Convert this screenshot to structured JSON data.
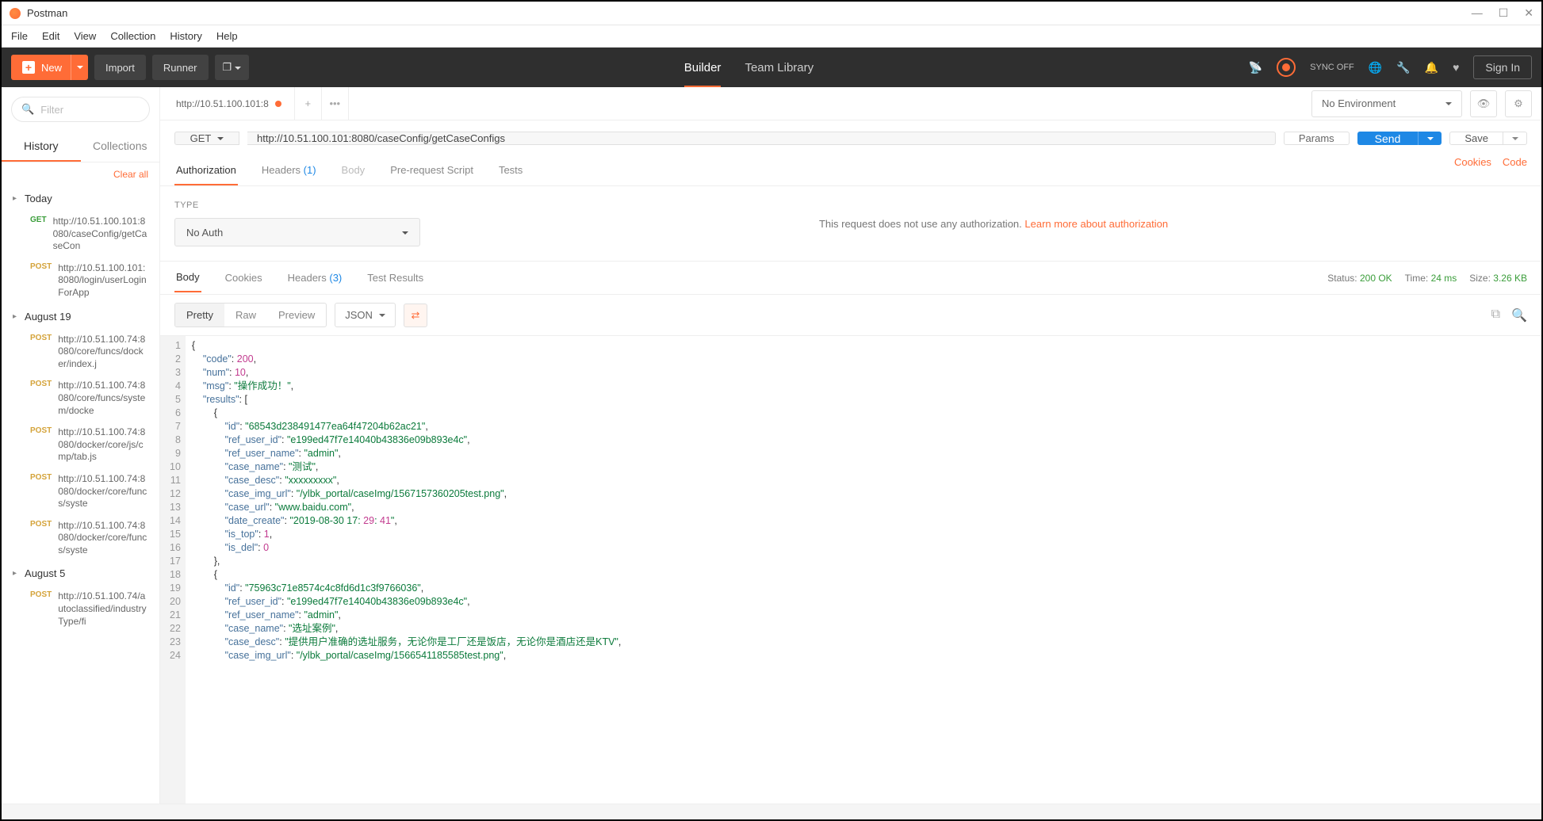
{
  "title": "Postman",
  "menus": [
    "File",
    "Edit",
    "View",
    "Collection",
    "History",
    "Help"
  ],
  "toolbar": {
    "new": "New",
    "import": "Import",
    "runner": "Runner",
    "builder": "Builder",
    "team_library": "Team Library",
    "sync": "SYNC OFF",
    "signin": "Sign In"
  },
  "sidebar": {
    "filter_placeholder": "Filter",
    "tabs": {
      "history": "History",
      "collections": "Collections"
    },
    "clear": "Clear all",
    "groups": [
      {
        "label": "Today",
        "items": [
          {
            "method": "GET",
            "url": "http://10.51.100.101:8080/caseConfig/getCaseCon"
          },
          {
            "method": "POST",
            "url": "http://10.51.100.101:8080/login/userLoginForApp"
          }
        ]
      },
      {
        "label": "August 19",
        "items": [
          {
            "method": "POST",
            "url": "http://10.51.100.74:8080/core/funcs/docker/index.j"
          },
          {
            "method": "POST",
            "url": "http://10.51.100.74:8080/core/funcs/system/docke"
          },
          {
            "method": "POST",
            "url": "http://10.51.100.74:8080/docker/core/js/cmp/tab.js"
          },
          {
            "method": "POST",
            "url": "http://10.51.100.74:8080/docker/core/funcs/syste"
          },
          {
            "method": "POST",
            "url": "http://10.51.100.74:8080/docker/core/funcs/syste"
          }
        ]
      },
      {
        "label": "August 5",
        "items": [
          {
            "method": "POST",
            "url": "http://10.51.100.74/autoclassified/industryType/fi"
          }
        ]
      }
    ]
  },
  "tabs": {
    "open": [
      {
        "label": "http://10.51.100.101:8",
        "dirty": true
      }
    ]
  },
  "env": {
    "selected": "No Environment"
  },
  "request": {
    "method": "GET",
    "url": "http://10.51.100.101:8080/caseConfig/getCaseConfigs",
    "params": "Params",
    "send": "Send",
    "save": "Save",
    "tabs": {
      "auth": "Authorization",
      "headers": "Headers",
      "headers_cnt": "(1)",
      "body": "Body",
      "prereq": "Pre-request Script",
      "tests": "Tests"
    },
    "cookies": "Cookies",
    "code": "Code",
    "auth_type_label": "TYPE",
    "auth_type": "No Auth",
    "auth_msg": "This request does not use any authorization. ",
    "auth_link": "Learn more about authorization"
  },
  "response": {
    "tabs": {
      "body": "Body",
      "cookies": "Cookies",
      "headers": "Headers",
      "headers_cnt": "(3)",
      "tests": "Test Results"
    },
    "status_label": "Status:",
    "status": "200 OK",
    "time_label": "Time:",
    "time": "24 ms",
    "size_label": "Size:",
    "size": "3.26 KB",
    "view": {
      "pretty": "Pretty",
      "raw": "Raw",
      "preview": "Preview",
      "format": "JSON"
    },
    "json_lines": [
      "{",
      "    \"code\": 200,",
      "    \"num\": 10,",
      "    \"msg\": \"操作成功！\",",
      "    \"results\": [",
      "        {",
      "            \"id\": \"68543d238491477ea64f47204b62ac21\",",
      "            \"ref_user_id\": \"e199ed47f7e14040b43836e09b893e4c\",",
      "            \"ref_user_name\": \"admin\",",
      "            \"case_name\": \"测试\",",
      "            \"case_desc\": \"xxxxxxxxx\",",
      "            \"case_img_url\": \"/ylbk_portal/caseImg/1567157360205test.png\",",
      "            \"case_url\": \"www.baidu.com\",",
      "            \"date_create\": \"2019-08-30 17:29:41\",",
      "            \"is_top\": 1,",
      "            \"is_del\": 0",
      "        },",
      "        {",
      "            \"id\": \"75963c71e8574c4c8fd6d1c3f9766036\",",
      "            \"ref_user_id\": \"e199ed47f7e14040b43836e09b893e4c\",",
      "            \"ref_user_name\": \"admin\",",
      "            \"case_name\": \"选址案例\",",
      "            \"case_desc\": \"提供用户准确的选址服务，无论你是工厂还是饭店，无论你是酒店还是KTV\",",
      "            \"case_img_url\": \"/ylbk_portal/caseImg/1566541185585test.png\","
    ]
  }
}
